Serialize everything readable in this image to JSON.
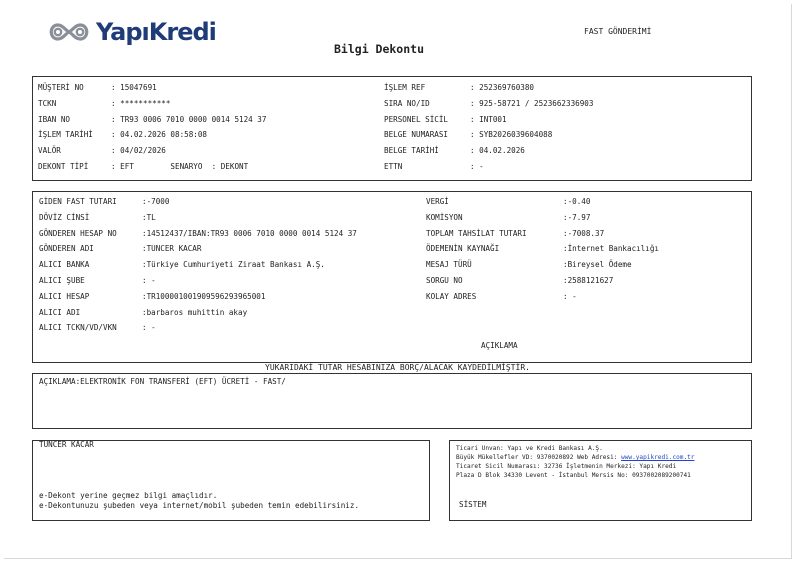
{
  "header": {
    "logo_text": "YapıKredi",
    "title": "Bilgi Dekontu",
    "transfer_type": "FAST GÖNDERİMİ"
  },
  "section1": {
    "left": [
      {
        "label": "MÜŞTERİ NO",
        "value": ": 15047691"
      },
      {
        "label": "TCKN",
        "value": ": ***********"
      },
      {
        "label": "IBAN NO",
        "value": ": TR93 0006 7010 0000 0014 5124 37"
      },
      {
        "label": "İŞLEM TARİHİ",
        "value": ": 04.02.2026 08:58:08"
      },
      {
        "label": "VALÖR",
        "value": ": 04/02/2026"
      },
      {
        "label": "DEKONT TİPİ",
        "value": ": EFT        SENARYO  : DEKONT"
      }
    ],
    "right": [
      {
        "label": "İŞLEM REF",
        "value": ": 252369760380"
      },
      {
        "label": "SIRA NO/ID",
        "value": ": 925-58721 / 2523662336903"
      },
      {
        "label": "PERSONEL SİCİL",
        "value": ": INT001"
      },
      {
        "label": "BELGE NUMARASI",
        "value": ": SYB2026039604088"
      },
      {
        "label": "BELGE TARİHİ",
        "value": ": 04.02.2026"
      },
      {
        "label": "ETTN",
        "value": ": -"
      }
    ]
  },
  "section2": {
    "left": [
      {
        "label": "GİDEN FAST TUTARI",
        "value": ":-7000"
      },
      {
        "label": "DÖVİZ CİNSİ",
        "value": ":TL"
      },
      {
        "label": "GÖNDEREN HESAP NO",
        "value": ":14512437/IBAN:TR93 0006 7010 0000 0014 5124 37"
      },
      {
        "label": "GÖNDEREN ADI",
        "value": ":TUNCER KACAR"
      },
      {
        "label": "ALICI BANKA",
        "value": ":Türkiye Cumhuriyeti Ziraat Bankası A.Ş."
      },
      {
        "label": "ALICI ŞUBE",
        "value": ": -"
      },
      {
        "label": "ALICI HESAP",
        "value": ":TR100001001909596293965001"
      },
      {
        "label": "ALICI ADI",
        "value": ":barbaros muhittin akay"
      },
      {
        "label": "ALICI TCKN/VD/VKN",
        "value": ": -"
      }
    ],
    "right": [
      {
        "label": "VERGİ",
        "value": ":-0.40"
      },
      {
        "label": "KOMİSYON",
        "value": ":-7.97"
      },
      {
        "label": "TOPLAM TAHSİLAT TUTARI",
        "value": ":-7008.37"
      },
      {
        "label": "ÖDEMENİN KAYNAĞI",
        "value": ":İnternet Bankacılığı"
      },
      {
        "label": "MESAJ TÜRÜ",
        "value": ":Bireysel Ödeme"
      },
      {
        "label": "SORGU NO",
        "value": ":2588121627"
      },
      {
        "label": "KOLAY ADRES",
        "value": ": -"
      }
    ],
    "aciklama_heading": "AÇIKLAMA"
  },
  "notice": "YUKARIDAKİ TUTAR HESABINIZA BORÇ/ALACAK KAYDEDİLMİŞTİR.",
  "description": "AÇIKLAMA:ELEKTRONİK FON TRANSFERİ (EFT) ÜCRETİ - FAST/",
  "footer_left": {
    "name": "TUNCER KACAR",
    "note1": "e-Dekont yerine geçmez bilgi amaçlıdır.",
    "note2": "e-Dekontunuzu şubeden veya internet/mobil şubeden temin edebilirsiniz."
  },
  "footer_right": {
    "line1": "Ticari Unvan: Yapı ve Kredi Bankası A.Ş.",
    "line2_prefix": "Büyük Mükellefler VD: 9370020892 Web Adresi: ",
    "line2_link": "www.yapikredi.com.tr",
    "line3": "Ticaret Sicil Numarası: 32736 İşletmenin Merkezi: Yapı Kredi",
    "line4": "Plaza D Blok 34330 Levent - İstanbul Mersis No: 0937002089200741",
    "sistem": "SİSTEM"
  },
  "colors": {
    "brand": "#1f3b78",
    "border": "#333333"
  }
}
